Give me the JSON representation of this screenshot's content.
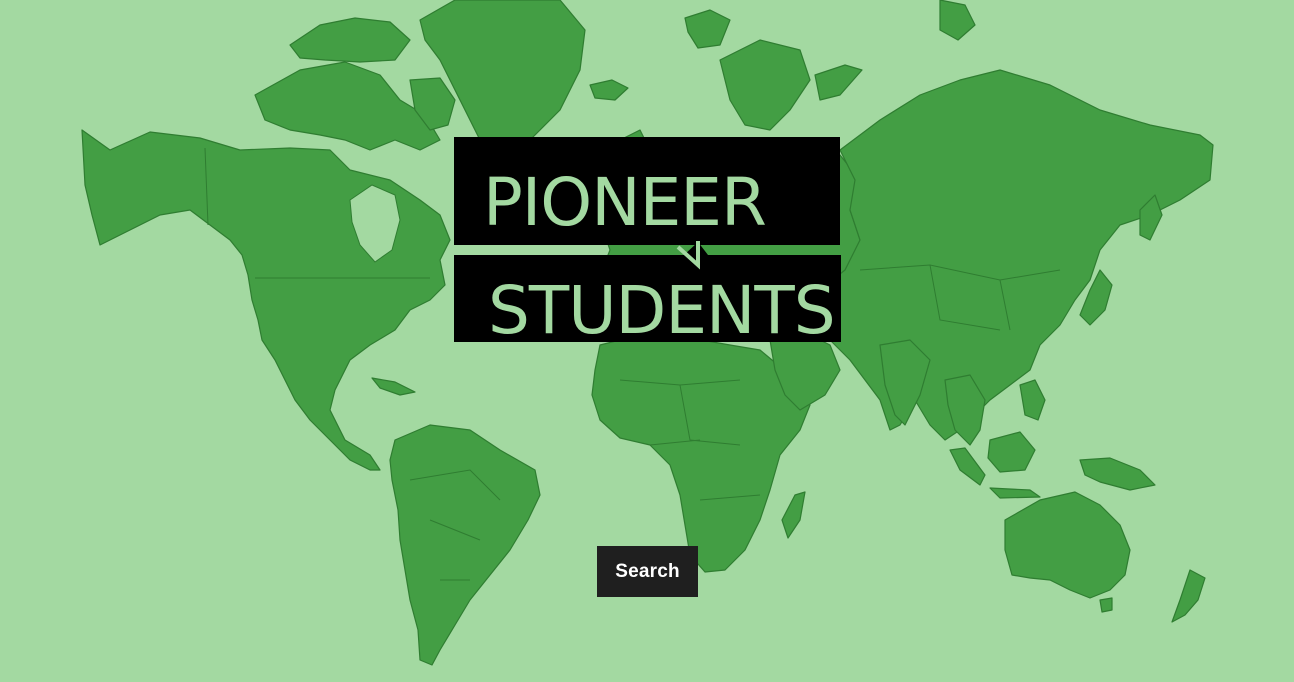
{
  "logo": {
    "line1": "PIONEER",
    "line2": "STUDENTS"
  },
  "search": {
    "label": "Search"
  },
  "colors": {
    "ocean": "#a3d9a1",
    "land": "#439e44",
    "logo_box": "#000000",
    "logo_text": "#a3d9a1",
    "button_bg": "#1f1f1f",
    "button_text": "#ffffff"
  }
}
